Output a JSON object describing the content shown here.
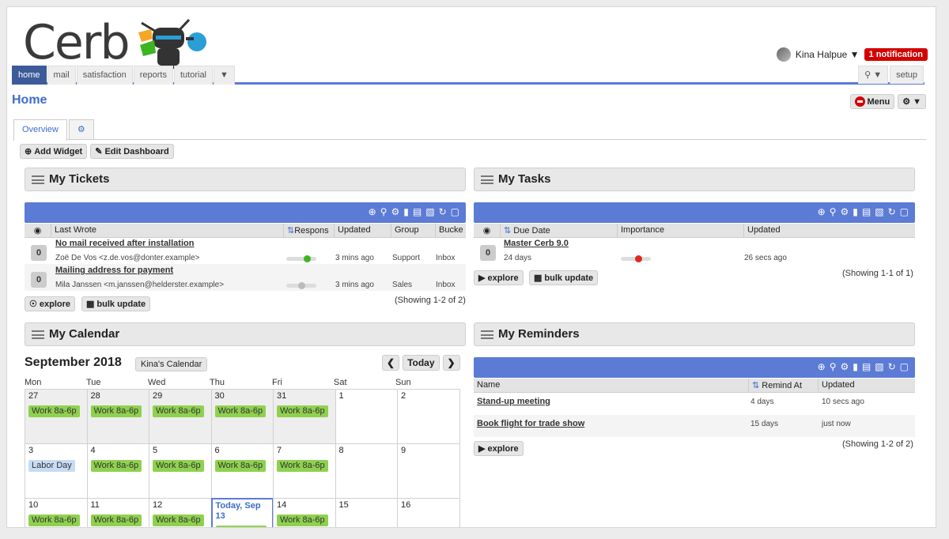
{
  "header": {
    "logo_text": "Cerb",
    "user_name": "Kina Halpue",
    "notification": "1 notification"
  },
  "nav": {
    "tabs": [
      "home",
      "mail",
      "satisfaction",
      "reports",
      "tutorial"
    ],
    "search_label": "Q",
    "setup_label": "setup"
  },
  "page": {
    "title": "Home",
    "menu_label": "Menu",
    "subtabs": [
      "Overview"
    ],
    "add_widget": "Add Widget",
    "edit_dashboard": "Edit Dashboard"
  },
  "tickets": {
    "title": "My Tickets",
    "columns": [
      "Last Wrote",
      "Respons",
      "Updated",
      "Group",
      "Bucke"
    ],
    "rows": [
      {
        "subject": "No mail received after installation",
        "from": "Zoë De Vos <z.de.vos@donter.example>",
        "updated": "3 mins ago",
        "group": "Support",
        "bucket": "Inbox",
        "count": "0",
        "status_level": 0.7,
        "status_color": "#3cb521"
      },
      {
        "subject": "Mailing address for payment",
        "from": "Mila Janssen <m.janssen@helderster.example>",
        "updated": "3 mins ago",
        "group": "Sales",
        "bucket": "Inbox",
        "count": "0",
        "status_level": 0.5,
        "status_color": "#bbbbbb"
      }
    ],
    "explore": "explore",
    "bulk": "bulk update",
    "showing": "(Showing 1-2 of 2)"
  },
  "tasks": {
    "title": "My Tasks",
    "columns": [
      "Due Date",
      "Importance",
      "Updated"
    ],
    "rows": [
      {
        "title": "Master Cerb 9.0",
        "due": "24 days",
        "updated": "26 secs ago",
        "count": "0",
        "importance_level": 0.6,
        "importance_color": "#e0281e"
      }
    ],
    "explore": "explore",
    "bulk": "bulk update",
    "showing": "(Showing 1-1 of 1)"
  },
  "calendar": {
    "title": "My Calendar",
    "month": "September 2018",
    "calendar_name": "Kina's Calendar",
    "today_btn": "Today",
    "days": [
      "Mon",
      "Tue",
      "Wed",
      "Thu",
      "Fri",
      "Sat",
      "Sun"
    ],
    "weeks": [
      [
        {
          "d": "27",
          "evt": "Work 8a-6p",
          "shaded": true
        },
        {
          "d": "28",
          "evt": "Work 8a-6p",
          "shaded": true
        },
        {
          "d": "29",
          "evt": "Work 8a-6p",
          "shaded": true
        },
        {
          "d": "30",
          "evt": "Work 8a-6p",
          "shaded": true
        },
        {
          "d": "31",
          "evt": "Work 8a-6p",
          "shaded": true
        },
        {
          "d": "1"
        },
        {
          "d": "2"
        }
      ],
      [
        {
          "d": "3",
          "evt": "Labor Day",
          "holiday": true
        },
        {
          "d": "4",
          "evt": "Work 8a-6p"
        },
        {
          "d": "5",
          "evt": "Work 8a-6p"
        },
        {
          "d": "6",
          "evt": "Work 8a-6p"
        },
        {
          "d": "7",
          "evt": "Work 8a-6p"
        },
        {
          "d": "8"
        },
        {
          "d": "9"
        }
      ],
      [
        {
          "d": "10",
          "evt": "Work 8a-6p"
        },
        {
          "d": "11",
          "evt": "Work 8a-6p"
        },
        {
          "d": "12",
          "evt": "Work 8a-6p"
        },
        {
          "d": "Today, Sep 13",
          "today": true,
          "evt": ""
        },
        {
          "d": "14",
          "evt": "Work 8a-6p"
        },
        {
          "d": "15"
        },
        {
          "d": "16"
        }
      ]
    ]
  },
  "reminders": {
    "title": "My Reminders",
    "columns": [
      "Name",
      "Remind At",
      "Updated"
    ],
    "rows": [
      {
        "name": "Stand-up meeting",
        "remind": "4 days",
        "updated": "10 secs ago"
      },
      {
        "name": "Book flight for trade show",
        "remind": "15 days",
        "updated": "just now"
      }
    ],
    "explore": "explore",
    "showing": "(Showing 1-2 of 2)"
  },
  "colors": {
    "accent": "#5b7bd5",
    "nav_active": "#3d5a99",
    "event": "#8fd14f",
    "notification": "#d40000"
  }
}
